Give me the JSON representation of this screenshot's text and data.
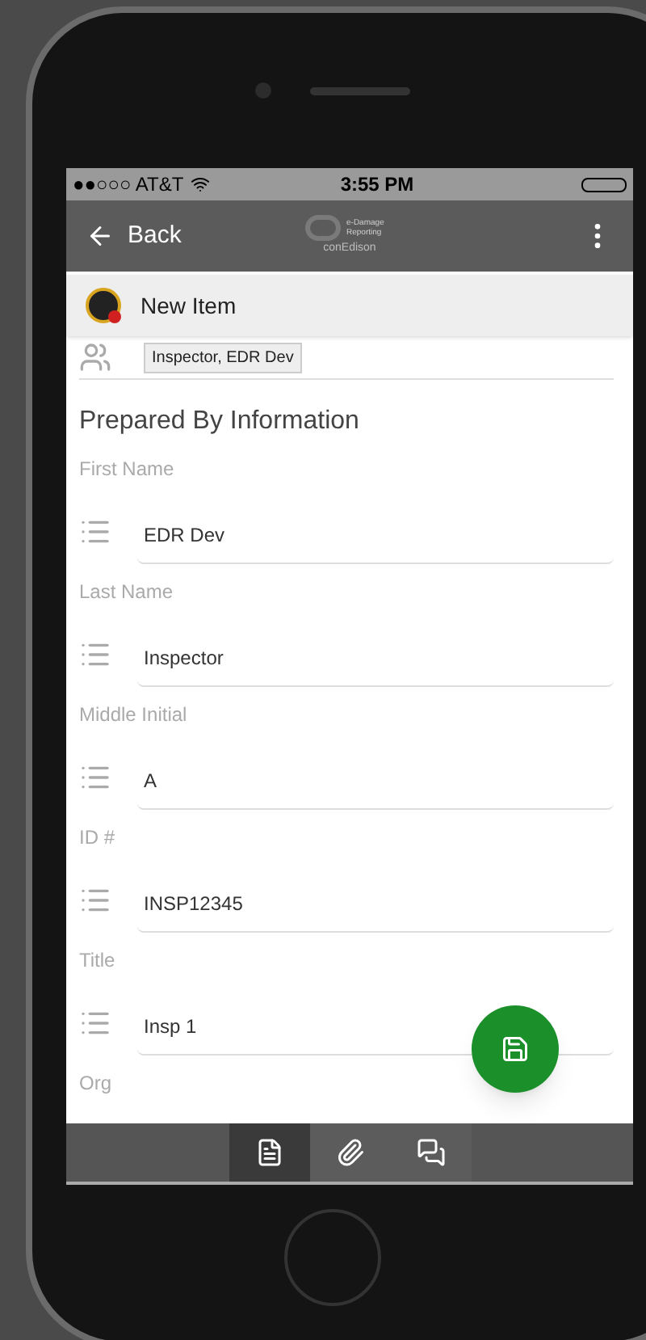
{
  "status_bar": {
    "carrier": "●●○○○ AT&T",
    "time": "3:55 PM"
  },
  "header": {
    "back": "Back",
    "logo_text": "e-Damage Reporting",
    "logo_caption": "conEdison"
  },
  "title_bar": {
    "title": "New Item"
  },
  "assignee": {
    "value": "Inspector, EDR Dev"
  },
  "section": {
    "title": "Prepared By Information"
  },
  "fields": [
    {
      "label": "First Name",
      "value": "EDR Dev"
    },
    {
      "label": "Last Name",
      "value": "Inspector"
    },
    {
      "label": "Middle Initial",
      "value": "A"
    },
    {
      "label": "ID #",
      "value": "INSP12345"
    },
    {
      "label": "Title",
      "value": "Insp 1"
    },
    {
      "label": "Org"
    }
  ],
  "bottom_tabs": [
    {
      "kind": "document",
      "selected": true
    },
    {
      "kind": "attachment",
      "selected": false
    },
    {
      "kind": "comments",
      "selected": false
    }
  ]
}
